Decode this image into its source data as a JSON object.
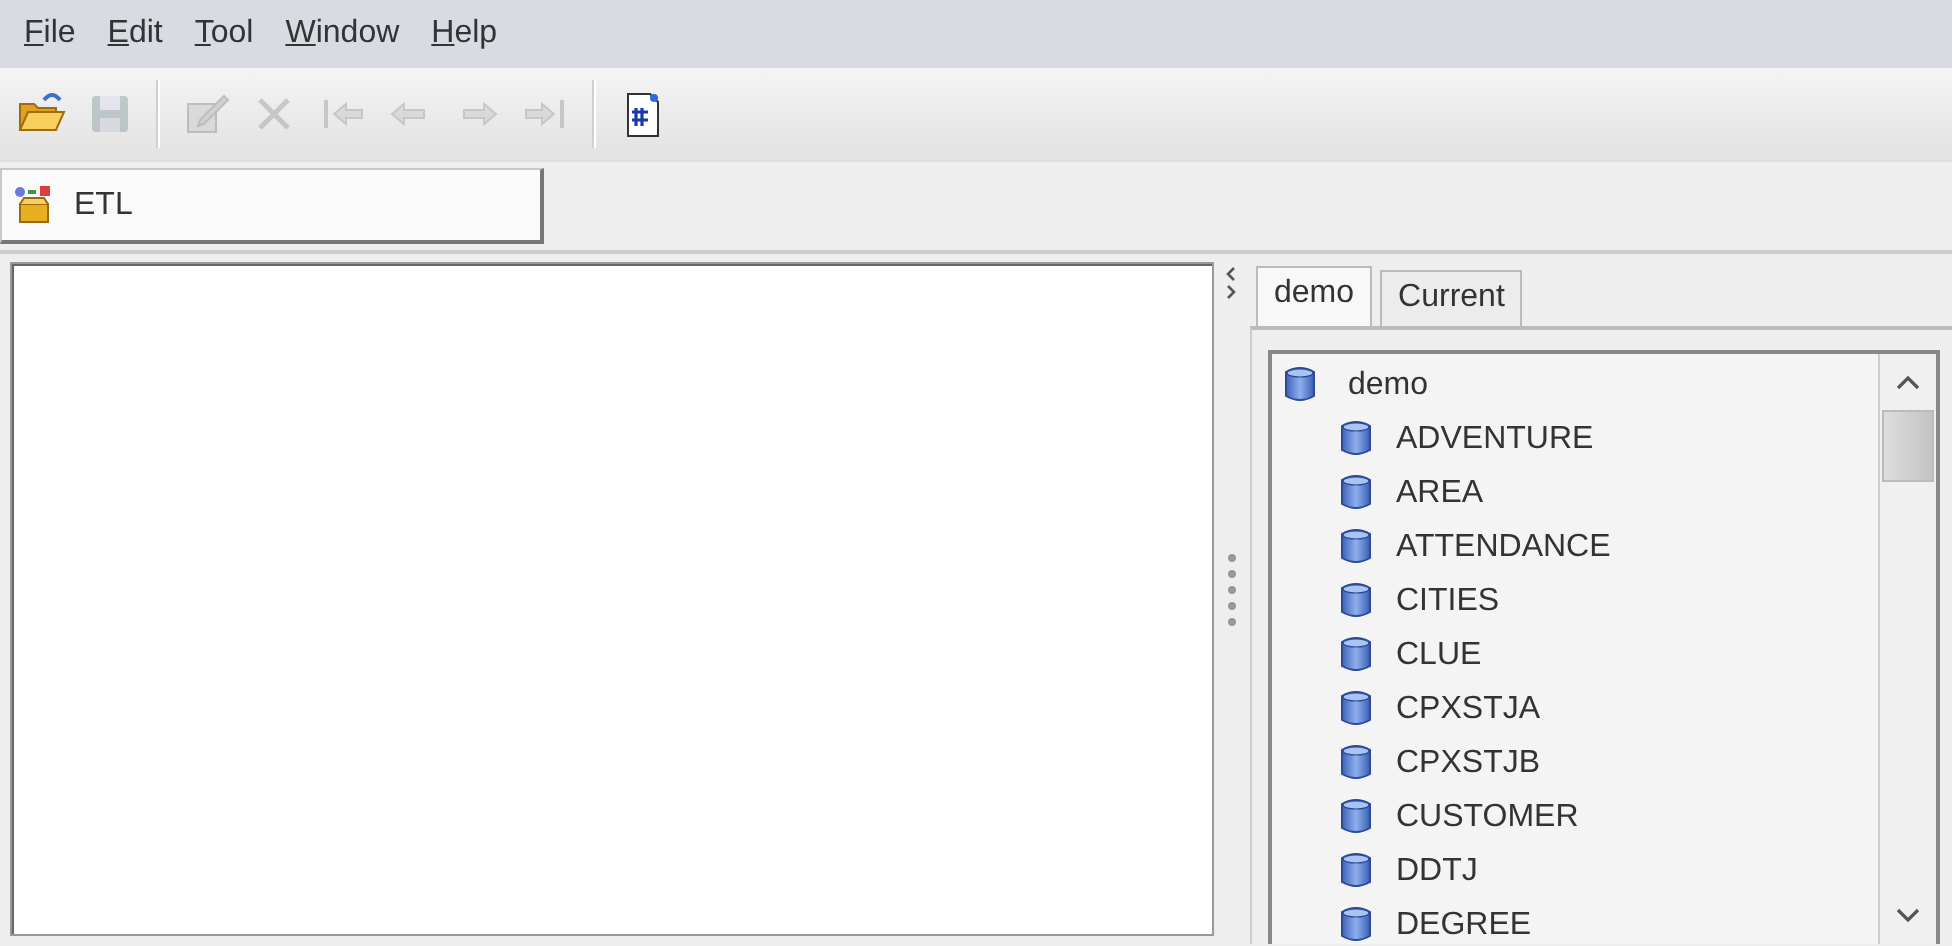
{
  "menu": [
    "File",
    "Edit",
    "Tool",
    "Window",
    "Help"
  ],
  "toolbar": [
    {
      "kind": "open",
      "disabled": false
    },
    {
      "kind": "save",
      "disabled": true
    },
    {
      "kind": "separator"
    },
    {
      "kind": "edit",
      "disabled": true
    },
    {
      "kind": "delete",
      "disabled": true
    },
    {
      "kind": "first",
      "disabled": true
    },
    {
      "kind": "prev",
      "disabled": true
    },
    {
      "kind": "next",
      "disabled": true
    },
    {
      "kind": "last",
      "disabled": true
    },
    {
      "kind": "separator"
    },
    {
      "kind": "hash-doc",
      "disabled": false
    }
  ],
  "module_button": {
    "label": "ETL"
  },
  "tabs": [
    {
      "label": "demo",
      "selected": true
    },
    {
      "label": "Current",
      "selected": false
    }
  ],
  "tree": [
    {
      "label": "demo",
      "children": [
        {
          "label": "ADVENTURE"
        },
        {
          "label": "AREA"
        },
        {
          "label": "ATTENDANCE"
        },
        {
          "label": "CITIES"
        },
        {
          "label": "CLUE"
        },
        {
          "label": "CPXSTJA"
        },
        {
          "label": "CPXSTJB"
        },
        {
          "label": "CUSTOMER"
        },
        {
          "label": "DDTJ"
        },
        {
          "label": "DEGREE"
        }
      ]
    }
  ]
}
